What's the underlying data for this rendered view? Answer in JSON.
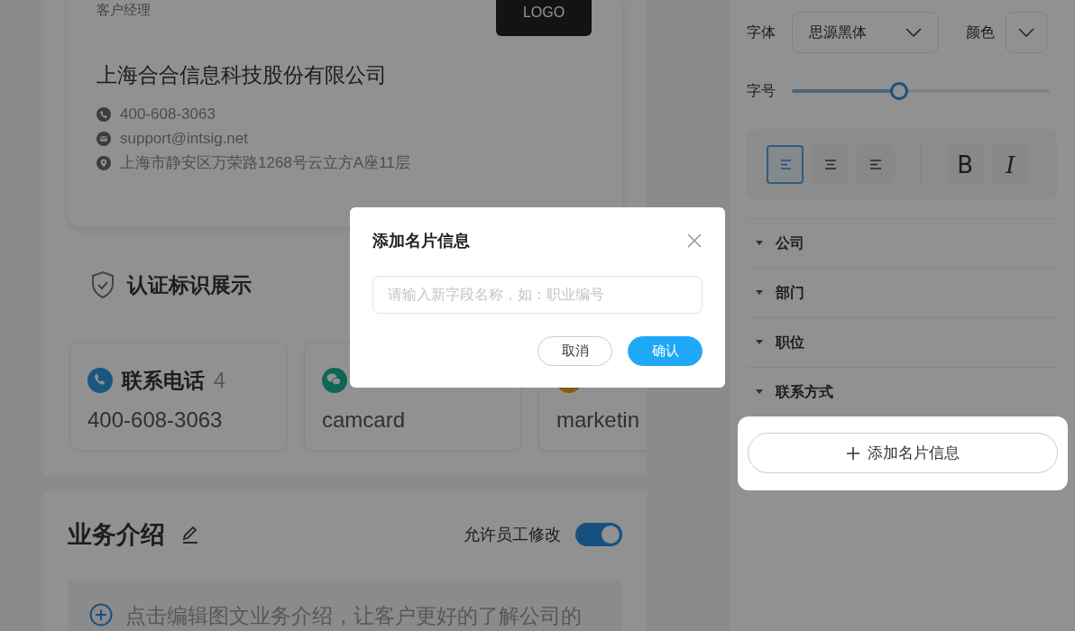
{
  "business_card": {
    "role": "客户经理",
    "logo": "LOGO",
    "company": "上海合合信息科技股份有限公司",
    "contacts": [
      {
        "kind": "phone",
        "text": "400-608-3063"
      },
      {
        "kind": "email",
        "text": "support@intsig.net"
      },
      {
        "kind": "location",
        "text": "上海市静安区万荣路1268号云立方A座11层"
      }
    ]
  },
  "certification": {
    "title": "认证标识展示",
    "cards": [
      {
        "kind": "phone",
        "title": "联系电话",
        "count": "4",
        "value": "400-608-3063"
      },
      {
        "kind": "wechat",
        "value": "camcard"
      },
      {
        "kind": "dot",
        "value": "marketin"
      }
    ]
  },
  "business_intro": {
    "title": "业务介绍",
    "allow_label": "允许员工修改",
    "allow_on": true,
    "hint": "点击编辑图文业务介绍，让客户更好的了解公司的"
  },
  "style_panel": {
    "font_label": "字体",
    "font_value": "思源黑体",
    "color_label": "颜色",
    "size_label": "字号",
    "size_slider": {
      "level": 0.41
    },
    "align_buttons": [
      {
        "kind": "left",
        "selected": true
      },
      {
        "kind": "center",
        "selected": false
      },
      {
        "kind": "right",
        "selected": false
      }
    ],
    "format_buttons": [
      {
        "kind": "bold",
        "label": "B"
      },
      {
        "kind": "italic",
        "label": "I"
      }
    ]
  },
  "sections": [
    {
      "label": "公司"
    },
    {
      "label": "部门"
    },
    {
      "label": "职位"
    },
    {
      "label": "联系方式"
    }
  ],
  "add_button": {
    "label": "添加名片信息"
  },
  "dialog": {
    "title": "添加名片信息",
    "placeholder": "请输入新字段名称，如：职业编号",
    "buttons": [
      {
        "kind": "secondary",
        "label": "取消"
      },
      {
        "kind": "primary",
        "label": "确认"
      }
    ]
  }
}
